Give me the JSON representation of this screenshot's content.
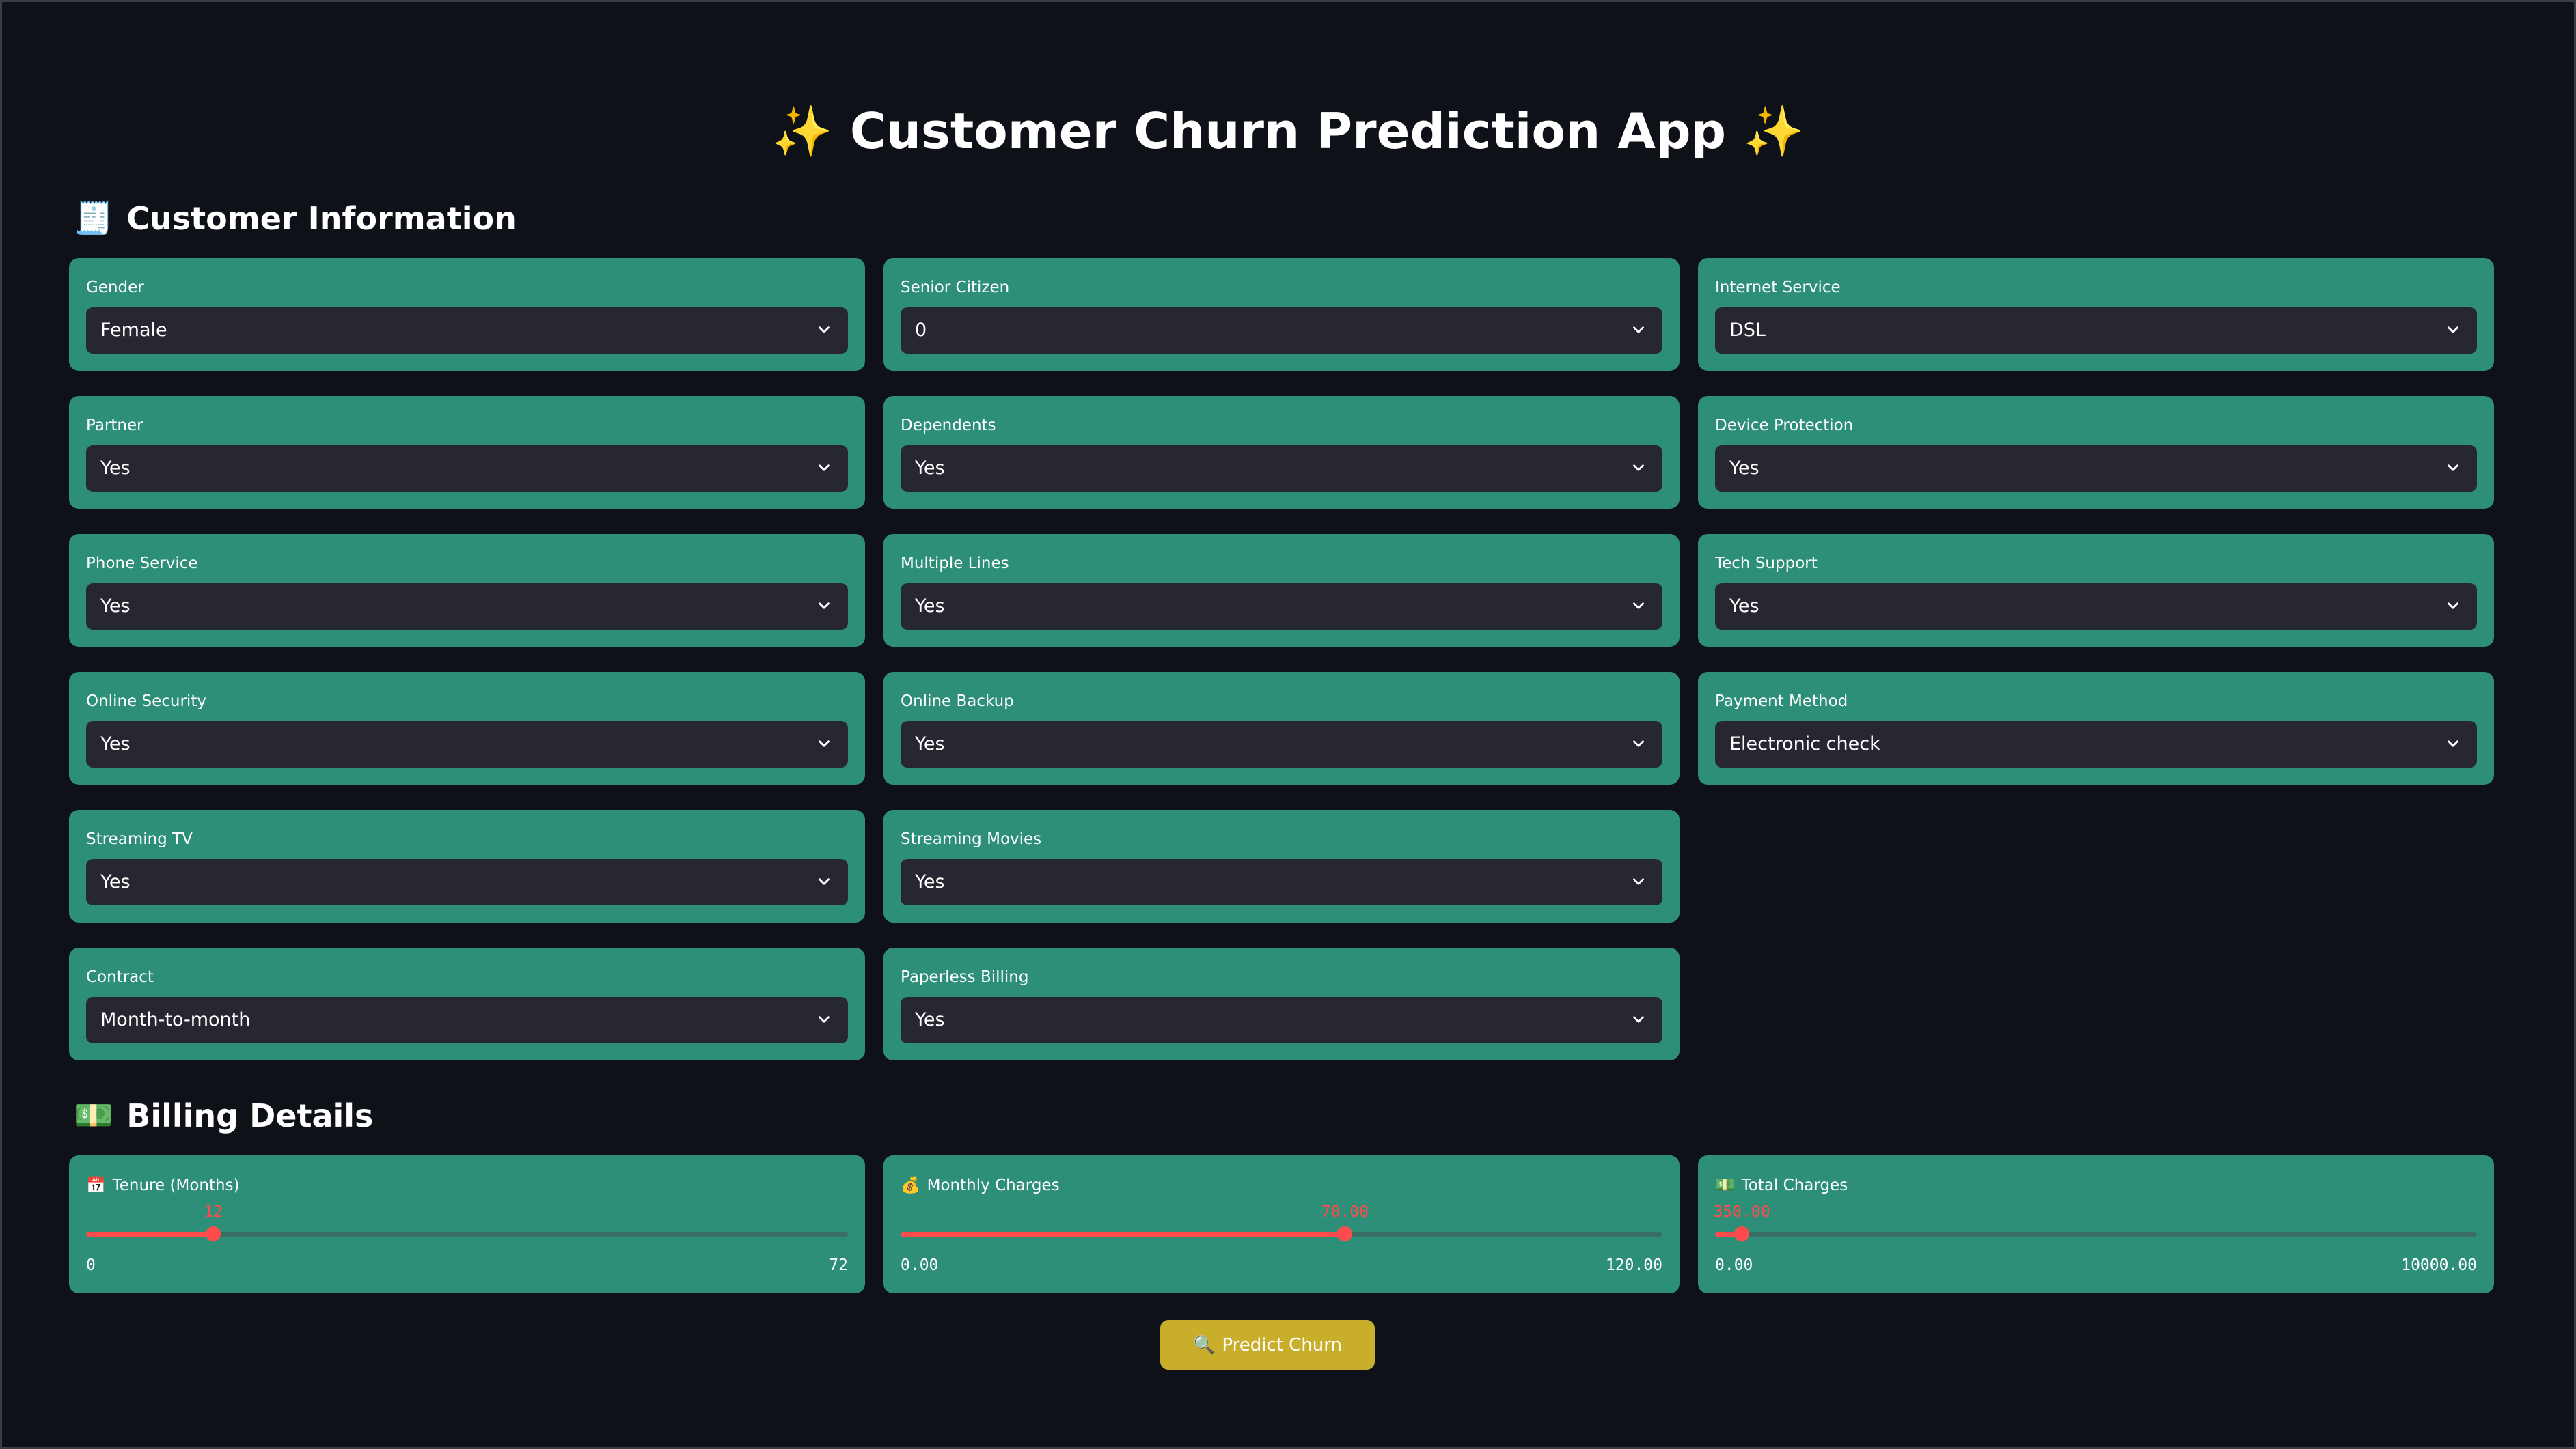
{
  "app": {
    "title": "Customer Churn Prediction App",
    "title_emoji_left": "✨",
    "title_emoji_right": "✨"
  },
  "sections": {
    "customer_info": {
      "emoji": "🧾",
      "label": "Customer Information"
    },
    "billing": {
      "emoji": "💵",
      "label": "Billing Details"
    }
  },
  "fields": {
    "gender": {
      "label": "Gender",
      "value": "Female"
    },
    "senior_citizen": {
      "label": "Senior Citizen",
      "value": "0"
    },
    "internet_service": {
      "label": "Internet Service",
      "value": "DSL"
    },
    "partner": {
      "label": "Partner",
      "value": "Yes"
    },
    "dependents": {
      "label": "Dependents",
      "value": "Yes"
    },
    "device_protection": {
      "label": "Device Protection",
      "value": "Yes"
    },
    "phone_service": {
      "label": "Phone Service",
      "value": "Yes"
    },
    "multiple_lines": {
      "label": "Multiple Lines",
      "value": "Yes"
    },
    "tech_support": {
      "label": "Tech Support",
      "value": "Yes"
    },
    "online_security": {
      "label": "Online Security",
      "value": "Yes"
    },
    "online_backup": {
      "label": "Online Backup",
      "value": "Yes"
    },
    "payment_method": {
      "label": "Payment Method",
      "value": "Electronic check"
    },
    "streaming_tv": {
      "label": "Streaming TV",
      "value": "Yes"
    },
    "streaming_movies": {
      "label": "Streaming Movies",
      "value": "Yes"
    },
    "contract": {
      "label": "Contract",
      "value": "Month-to-month"
    },
    "paperless_billing": {
      "label": "Paperless Billing",
      "value": "Yes"
    }
  },
  "sliders": {
    "tenure": {
      "emoji": "📅",
      "label": "Tenure (Months)",
      "value": "12",
      "min": "0",
      "max": "72",
      "fraction": 0.1667
    },
    "monthly_charges": {
      "emoji": "💰",
      "label": "Monthly Charges",
      "value": "70.00",
      "min": "0.00",
      "max": "120.00",
      "fraction": 0.5833
    },
    "total_charges": {
      "emoji": "💵",
      "label": "Total Charges",
      "value": "350.00",
      "min": "0.00",
      "max": "10000.00",
      "fraction": 0.035
    }
  },
  "predict_button": {
    "emoji": "🔍",
    "label": "Predict Churn"
  },
  "colors": {
    "background": "#0e1117",
    "card": "#2e8f78",
    "select": "#262730",
    "slider_accent": "#ff4b4b",
    "button": "#c9ae2c"
  },
  "icons": {
    "select_chevron": "chevron-down-icon"
  }
}
